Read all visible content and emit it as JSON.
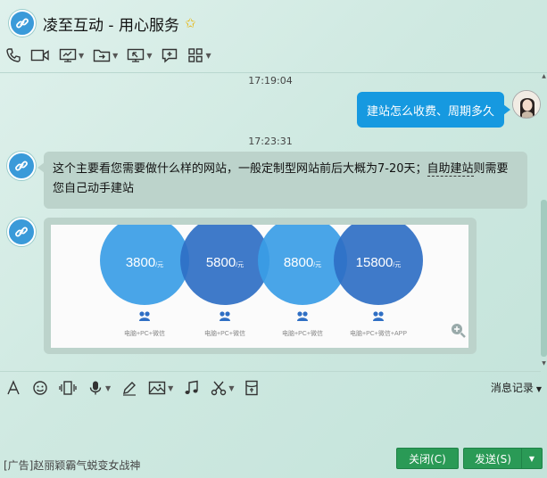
{
  "window": {
    "title": "凌至互动 - 用心服务",
    "star_icon": "star-icon"
  },
  "toolbar": {
    "items": [
      "phone-icon",
      "video-icon",
      "screen-share-icon",
      "file-transfer-icon",
      "remote-desktop-icon",
      "new-chat-icon",
      "apps-grid-icon"
    ]
  },
  "chat": {
    "messages": [
      {
        "time": "17:19:04",
        "from": "me",
        "text": "建站怎么收费、周期多久"
      },
      {
        "time": "17:23:31",
        "from": "them",
        "text_part1": "这个主要看您需要做什么样的网站，一般定制型网站前后大概为7-20天；",
        "text_underlined": "自助建站",
        "text_part2": "则需要您自己动手建站"
      },
      {
        "from": "them",
        "type": "image"
      }
    ],
    "pricing_image": {
      "plans": [
        {
          "price": "3800",
          "unit": "/元",
          "desc": "电脑+PC+微信",
          "color": "#3a9de6"
        },
        {
          "price": "5800",
          "unit": "/元",
          "desc": "电脑+PC+微信",
          "color": "#2f6fc4"
        },
        {
          "price": "8800",
          "unit": "/元",
          "desc": "电脑+PC+微信",
          "color": "#3a9de6"
        },
        {
          "price": "15800",
          "unit": "/元",
          "desc": "电脑+PC+微信+APP",
          "color": "#2f6fc4"
        }
      ]
    }
  },
  "input_toolbar": {
    "items": [
      "font-icon",
      "emoji-icon",
      "shake-icon",
      "voice-icon",
      "handwriting-icon",
      "image-icon",
      "music-icon",
      "screenshot-icon",
      "red-packet-icon"
    ],
    "history_label": "消息记录"
  },
  "footer": {
    "ad_text": "[广告]赵丽颖霸气蜕变女战神",
    "close_label": "关闭(C)",
    "send_label": "发送(S)"
  }
}
